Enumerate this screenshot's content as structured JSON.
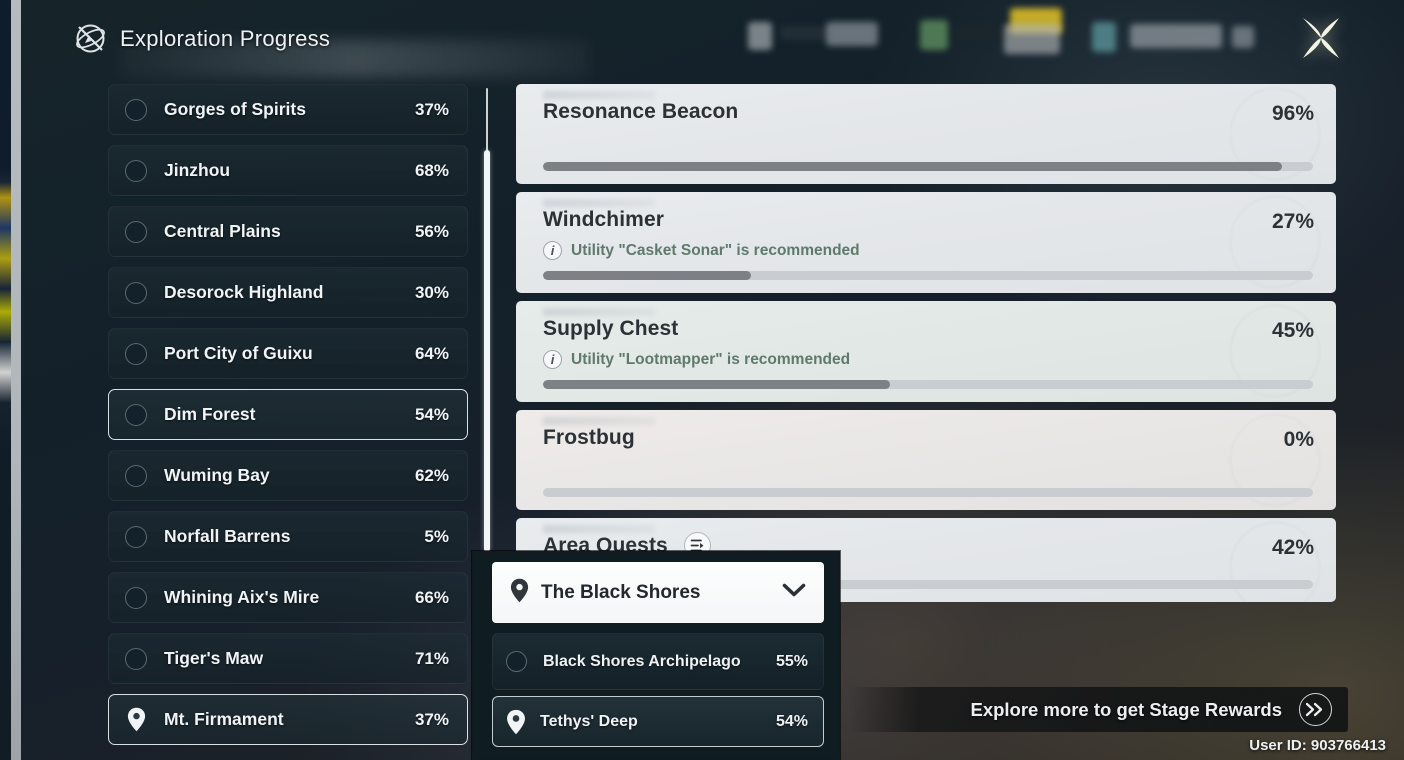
{
  "header": {
    "title": "Exploration Progress",
    "compass_icon": "compass-slash-icon",
    "close_icon": "close-star-icon"
  },
  "sidebar": {
    "regions": [
      {
        "name": "Gorges of Spirits",
        "percent": "37%",
        "icon": "circle-dot",
        "selected": false
      },
      {
        "name": "Jinzhou",
        "percent": "68%",
        "icon": "circle-dot",
        "selected": false
      },
      {
        "name": "Central Plains",
        "percent": "56%",
        "icon": "circle-dot",
        "selected": false
      },
      {
        "name": "Desorock Highland",
        "percent": "30%",
        "icon": "circle-dot",
        "selected": false
      },
      {
        "name": "Port City of Guixu",
        "percent": "64%",
        "icon": "circle-dot",
        "selected": false
      },
      {
        "name": "Dim Forest",
        "percent": "54%",
        "icon": "circle-dot",
        "selected": true
      },
      {
        "name": "Wuming Bay",
        "percent": "62%",
        "icon": "circle-dot",
        "selected": false
      },
      {
        "name": "Norfall Barrens",
        "percent": "5%",
        "icon": "circle-dot",
        "selected": false
      },
      {
        "name": "Whining Aix's Mire",
        "percent": "66%",
        "icon": "circle-dot",
        "selected": false
      },
      {
        "name": "Tiger's Maw",
        "percent": "71%",
        "icon": "circle-dot",
        "selected": false
      },
      {
        "name": "Mt. Firmament",
        "percent": "37%",
        "icon": "location-pin",
        "selected": true
      }
    ]
  },
  "main": {
    "cards": [
      {
        "title": "Resonance Beacon",
        "percent": "96%",
        "fill": 96,
        "sub": null,
        "tint": "plain"
      },
      {
        "title": "Windchimer",
        "percent": "27%",
        "fill": 27,
        "sub": "Utility \"Casket Sonar\" is recommended",
        "tint": "plain"
      },
      {
        "title": "Supply Chest",
        "percent": "45%",
        "fill": 45,
        "sub": "Utility \"Lootmapper\" is recommended",
        "tint": "green"
      },
      {
        "title": "Frostbug",
        "percent": "0%",
        "fill": 0,
        "sub": null,
        "tint": "warm"
      },
      {
        "title": "Area Quests",
        "percent": "42%",
        "fill": 3,
        "sub": null,
        "tint": "plain",
        "icon": "quest-list-icon"
      }
    ],
    "info_icon_glyph": "i"
  },
  "dropdown": {
    "selected": "The Black Shores",
    "pin_icon": "location-pin-icon",
    "chevron_icon": "chevron-down-icon",
    "items": [
      {
        "name": "Black Shores Archipelago",
        "percent": "55%",
        "icon": "circle-dot",
        "selected": false
      },
      {
        "name": "Tethys' Deep",
        "percent": "54%",
        "icon": "location-pin",
        "selected": true
      }
    ]
  },
  "footer": {
    "reward_text": "Explore more to get Stage Rewards",
    "reward_arrow": "double-chevron-right-icon",
    "user_id": "User ID: 903766413"
  }
}
